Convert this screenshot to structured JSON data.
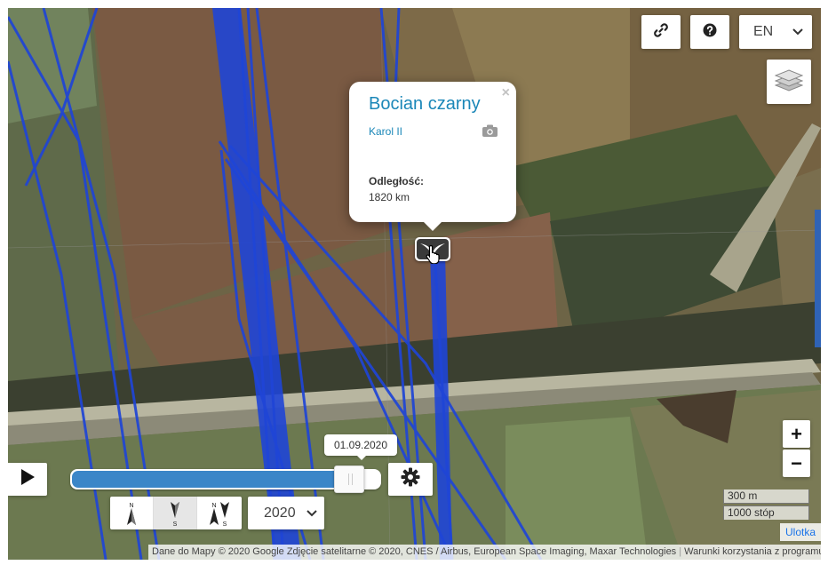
{
  "header": {
    "language": "EN",
    "link_icon": "link-icon",
    "help_icon": "question-circle-icon",
    "layers_icon": "layers-icon"
  },
  "popup": {
    "title": "Bocian czarny",
    "subtitle": "Karol II",
    "close": "×",
    "distance_label": "Odległość:",
    "distance_value": "1820 km"
  },
  "zoom": {
    "in_label": "+",
    "out_label": "−"
  },
  "timeline": {
    "date": "01.09.2020",
    "progress": 0.93,
    "year": "2020",
    "direction_labels": {
      "north": "N",
      "south": "S"
    }
  },
  "scale": {
    "metric": "300 m",
    "imperial": "1000 stóp"
  },
  "legend_label": "Ulotka",
  "attribution": {
    "text": "Dane do Mapy © 2020 Google Zdjęcie satelitarne © 2020, CNES / Airbus, European Space Imaging, Maxar Technologies",
    "terms": "Warunki korzystania z programu"
  },
  "colors": {
    "track": "#1f45d6",
    "accent": "#1b87b8",
    "slider": "#3b86c8"
  }
}
